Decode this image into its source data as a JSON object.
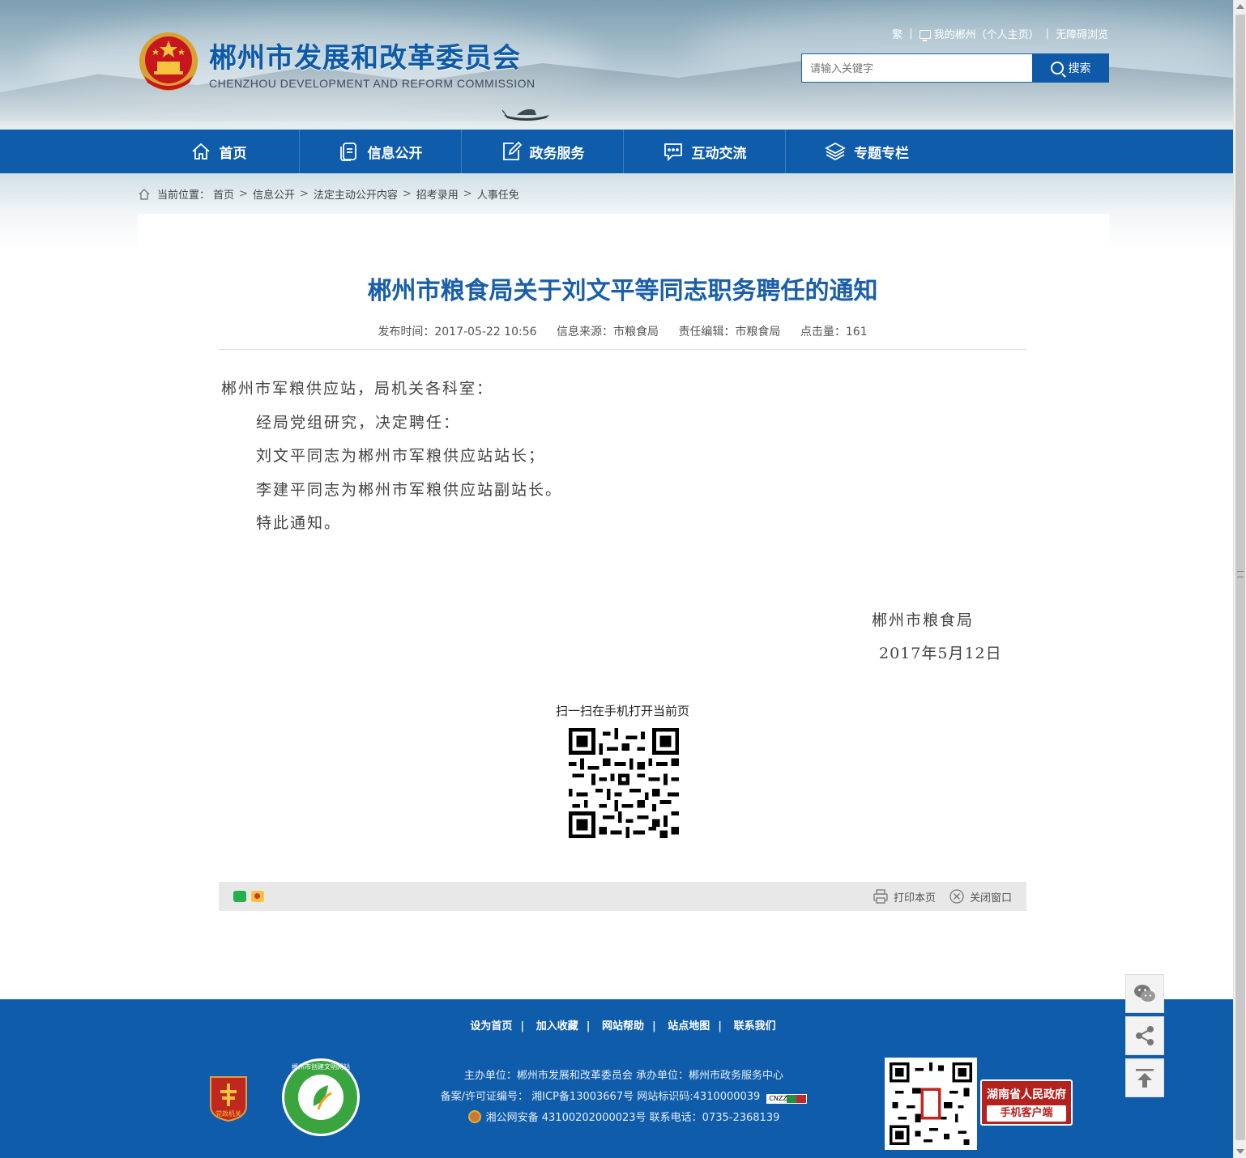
{
  "header": {
    "site_name_cn": "郴州市发展和改革委员会",
    "site_name_en": "CHENZHOU DEVELOPMENT AND REFORM COMMISSION",
    "top_links": {
      "traditional": "繁",
      "my_chenzhou": "我的郴州（个人主页）",
      "accessibility": "无障碍浏览"
    },
    "search": {
      "placeholder": "请输入关键字",
      "button": "搜索"
    }
  },
  "nav": {
    "items": [
      {
        "label": "首页",
        "icon": "home-icon"
      },
      {
        "label": "信息公开",
        "icon": "document-icon"
      },
      {
        "label": "政务服务",
        "icon": "edit-icon"
      },
      {
        "label": "互动交流",
        "icon": "chat-icon"
      },
      {
        "label": "专题专栏",
        "icon": "layers-icon"
      }
    ]
  },
  "breadcrumb": {
    "prefix": "当前位置：",
    "items": [
      "首页",
      "信息公开",
      "法定主动公开内容",
      "招考录用",
      "人事任免"
    ],
    "separator": ">"
  },
  "article": {
    "title": "郴州市粮食局关于刘文平等同志职务聘任的通知",
    "meta": {
      "publish_time": "发布时间：2017-05-22 10:56",
      "source": "信息来源：市粮食局",
      "editor": "责任编辑：市粮食局",
      "clicks": "点击量：161"
    },
    "paragraphs": [
      "郴州市军粮供应站，局机关各科室：",
      "经局党组研究，决定聘任：",
      "刘文平同志为郴州市军粮供应站站长；",
      "李建平同志为郴州市军粮供应站副站长。",
      "特此通知。"
    ],
    "signature": "郴州市粮食局",
    "date": "2017年5月12日",
    "qr_caption": "扫一扫在手机打开当前页"
  },
  "toolbar": {
    "print": "打印本页",
    "close": "关闭窗口"
  },
  "footer": {
    "links": [
      "设为首页",
      "加入收藏",
      "网站帮助",
      "站点地图",
      "联系我们"
    ],
    "line1": "主办单位：郴州市发展和改革委员会   承办单位：郴州市政务服务中心",
    "line2": "备案/许可证编号：  湘ICP备13003667号   网站标识码:4310000039",
    "line3": "湘公网安备 43100202000023号   联系电话：0735-2368139",
    "badge_party": "党政机关",
    "badge_civil": "郴州市创建文明网站",
    "cnnic_label": "CNZZ",
    "app_title": "湖南省人民政府",
    "app_sub": "手机客户端"
  },
  "colors": {
    "brand_blue": "#0f5cab",
    "title_blue": "#1a5fa8",
    "app_red": "#b3221c"
  }
}
